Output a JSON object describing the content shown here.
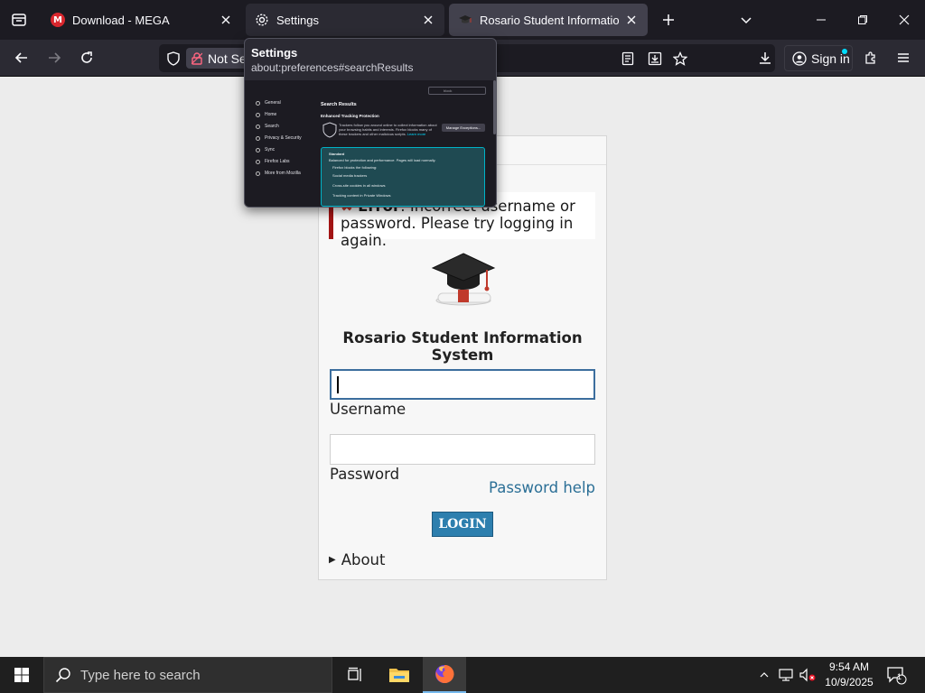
{
  "browser": {
    "tabs": [
      {
        "title": "Download - MEGA",
        "icon": "mega-icon",
        "favicon_text": "M"
      },
      {
        "title": "Settings",
        "icon": "gear-icon"
      },
      {
        "title": "Rosario Student Information Sy",
        "icon": "graduation-cap-icon"
      }
    ],
    "security_label": "Not Se",
    "sign_in_label": "Sign in"
  },
  "preview": {
    "title": "Settings",
    "url": "about:preferences#searchResults",
    "nav_items": [
      "General",
      "Home",
      "Search",
      "Privacy & Security",
      "Sync",
      "Firefox Labs",
      "More from Mozilla"
    ],
    "heading": "Search Results",
    "section": "Enhanced Tracking Protection",
    "description": "Trackers follow you around online to collect information about your browsing habits and interests. Firefox blocks many of these trackers and other malicious scripts.",
    "learn_more": "Learn more",
    "manage_button": "Manage Exceptions...",
    "search_value": "block",
    "standard_title": "Standard",
    "standard_desc": "Balanced for protection and performance. Pages will load normally.",
    "standard_blocks": "Firefox blocks the following:",
    "standard_items": [
      "Social media trackers",
      "Cross-site cookies in all windows",
      "Tracking content in Private Windows"
    ]
  },
  "page": {
    "header_text": "LOGIN",
    "error_label": "Error",
    "error_message": ": Incorrect username or password. Please try logging in again.",
    "system_title": "Rosario Student Information System",
    "username_label": "Username",
    "username_value": "",
    "password_label": "Password",
    "password_value": "",
    "password_help": "Password help",
    "login_button": "LOGIN",
    "about_label": "About"
  },
  "taskbar": {
    "search_placeholder": "Type here to search",
    "time": "9:54 AM",
    "date": "10/9/2025",
    "notification_count": "1"
  },
  "colors": {
    "accent": "#2d7fae",
    "error": "#a31515",
    "link": "#2b6f96"
  }
}
